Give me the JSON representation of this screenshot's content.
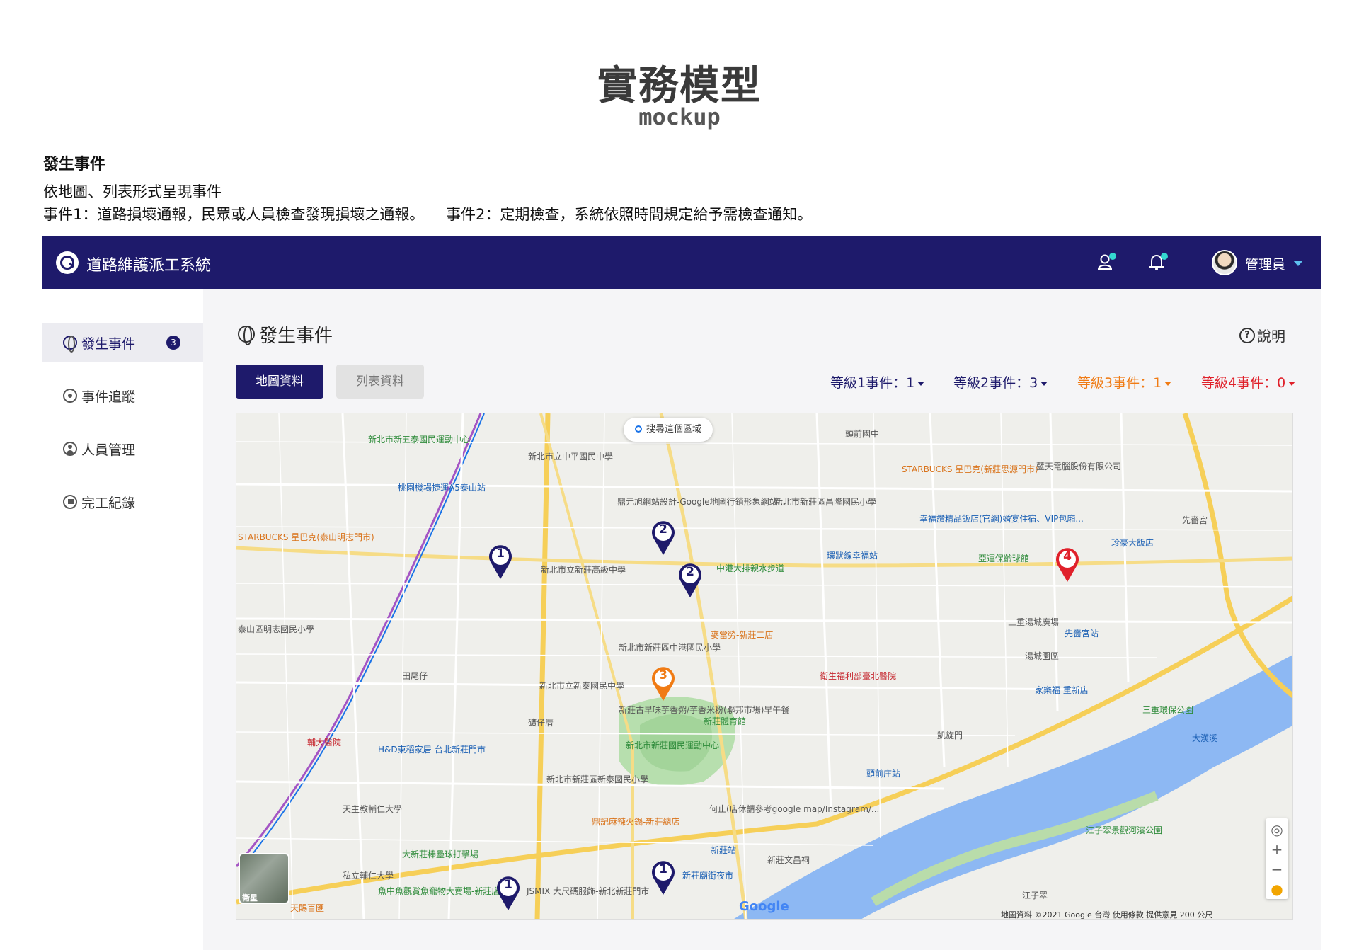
{
  "doc": {
    "title": "實務模型",
    "subtitle": "mockup",
    "section_heading": "發生事件",
    "desc_line1": "依地圖、列表形式呈現事件",
    "desc_line2a": "事件1：道路損壞通報，民眾或人員檢查發現損壞之通報。",
    "desc_line2b": "事件2：定期檢查，系統依照時間規定給予需檢查通知。"
  },
  "topbar": {
    "app_title": "道路維護派工系統",
    "user_name": "管理員",
    "colors": {
      "bar": "#1e1a6b",
      "notify_dot": "#34d8d0",
      "caret": "#5ec0f0"
    }
  },
  "sidebar": {
    "items": [
      {
        "label": "發生事件",
        "icon": "globe-icon",
        "badge": "3",
        "active": true
      },
      {
        "label": "事件追蹤",
        "icon": "eye-icon"
      },
      {
        "label": "人員管理",
        "icon": "person-icon"
      },
      {
        "label": "完工紀錄",
        "icon": "flag-icon"
      }
    ]
  },
  "main": {
    "heading": "發生事件",
    "help_label": "說明",
    "tabs": [
      {
        "label": "地圖資料",
        "active": true
      },
      {
        "label": "列表資料",
        "active": false
      }
    ],
    "levels": [
      {
        "label": "等級1事件：1",
        "color": "#1e1a6b"
      },
      {
        "label": "等級2事件：3",
        "color": "#1e1a6b"
      },
      {
        "label": "等級3事件：1",
        "color": "#f07b14"
      },
      {
        "label": "等級4事件：0",
        "color": "#e0202a"
      }
    ]
  },
  "map": {
    "search_area": "搜尋這個區域",
    "satellite_label": "衛星",
    "zoom_in": "+",
    "zoom_out": "−",
    "footer": "地圖資料 ©2021 Google   台灣   使用條款   提供意見   200 公尺",
    "google_logo": "Google",
    "places": [
      {
        "text": "新北市新五泰國民運動中心",
        "tone": "green"
      },
      {
        "text": "新北市立中平國民中學",
        "tone": "gray"
      },
      {
        "text": "頭前國中",
        "tone": "gray"
      },
      {
        "text": "STARBUCKS 星巴克(新莊思源門市)",
        "tone": "orange"
      },
      {
        "text": "藍天電腦股份有限公司",
        "tone": "gray"
      },
      {
        "text": "桃園機場捷運A5泰山站",
        "tone": "blue"
      },
      {
        "text": "鼎元旭網站設計-Google地圖行銷形象網站...",
        "tone": "gray"
      },
      {
        "text": "新北市新莊區昌隆國民小學",
        "tone": "gray"
      },
      {
        "text": "幸福讚精品飯店(官網)婚宴住宿、VIP包廂...",
        "tone": "blue"
      },
      {
        "text": "先嗇宮",
        "tone": "gray"
      },
      {
        "text": "STARBUCKS 星巴克(泰山明志門市)",
        "tone": "orange"
      },
      {
        "text": "新北市立新莊高級中學",
        "tone": "gray"
      },
      {
        "text": "中港大排親水步道",
        "tone": "green"
      },
      {
        "text": "環狀線幸福站",
        "tone": "blue"
      },
      {
        "text": "亞運保齡球館",
        "tone": "green"
      },
      {
        "text": "珍豪大飯店",
        "tone": "blue"
      },
      {
        "text": "三重湯城廣場",
        "tone": "gray"
      },
      {
        "text": "先嗇宮站",
        "tone": "blue"
      },
      {
        "text": "湯城園區",
        "tone": "gray"
      },
      {
        "text": "泰山區明志國民小學",
        "tone": "gray"
      },
      {
        "text": "麥當勞-新莊二店",
        "tone": "orange"
      },
      {
        "text": "新北市新莊區中港國民小學",
        "tone": "gray"
      },
      {
        "text": "田尾仔",
        "tone": "gray"
      },
      {
        "text": "新北市立新泰國民中學",
        "tone": "gray"
      },
      {
        "text": "衛生福利部臺北醫院",
        "tone": "red"
      },
      {
        "text": "家樂福 重新店",
        "tone": "blue"
      },
      {
        "text": "三重環保公園",
        "tone": "green"
      },
      {
        "text": "新莊古早味芋香粥/芋香米粉(聯邦市場)早午餐",
        "tone": "gray"
      },
      {
        "text": "新莊體育館",
        "tone": "green"
      },
      {
        "text": "礦仔厝",
        "tone": "gray"
      },
      {
        "text": "新北市新莊國民運動中心",
        "tone": "green"
      },
      {
        "text": "凱旋門",
        "tone": "gray"
      },
      {
        "text": "輔大醫院",
        "tone": "red"
      },
      {
        "text": "H&D東稻家居-台北新莊門市",
        "tone": "blue"
      },
      {
        "text": "頭前庄站",
        "tone": "blue"
      },
      {
        "text": "新北市新莊區新泰國民小學",
        "tone": "gray"
      },
      {
        "text": "大漢溪",
        "tone": "blue"
      },
      {
        "text": "天主教輔仁大學",
        "tone": "gray"
      },
      {
        "text": "何止(店休請參考google map/Instagram/...",
        "tone": "gray"
      },
      {
        "text": "鼎記麻辣火鍋-新莊總店",
        "tone": "orange"
      },
      {
        "text": "江子翠景觀河濱公園",
        "tone": "green"
      },
      {
        "text": "大新莊棒壘球打擊場",
        "tone": "green"
      },
      {
        "text": "新莊站",
        "tone": "blue"
      },
      {
        "text": "新莊文昌祠",
        "tone": "gray"
      },
      {
        "text": "私立輔仁大學",
        "tone": "gray"
      },
      {
        "text": "新莊廟街夜市",
        "tone": "blue"
      },
      {
        "text": "魚中魚觀賞魚寵物大賣場-新莊店",
        "tone": "green"
      },
      {
        "text": "JSMIX 大尺碼服飾-新北新莊門市",
        "tone": "gray"
      },
      {
        "text": "江子翠",
        "tone": "gray"
      },
      {
        "text": "天賜百匯",
        "tone": "orange"
      }
    ],
    "pins": [
      {
        "level": "1",
        "color": "#1e1a6b"
      },
      {
        "level": "2",
        "color": "#1e1a6b"
      },
      {
        "level": "2",
        "color": "#1e1a6b"
      },
      {
        "level": "4",
        "color": "#e0202a"
      },
      {
        "level": "3",
        "color": "#f07b14"
      },
      {
        "level": "1",
        "color": "#1e1a6b"
      },
      {
        "level": "1",
        "color": "#1e1a6b"
      }
    ]
  }
}
